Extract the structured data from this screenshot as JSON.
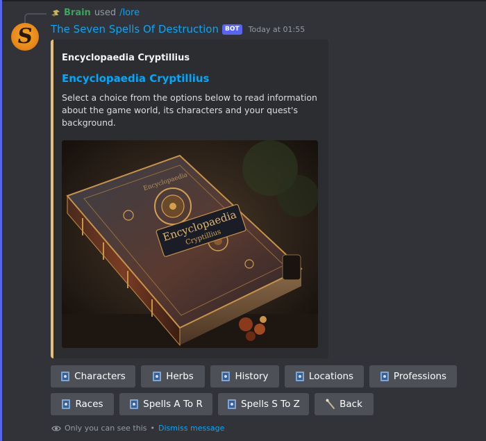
{
  "reply": {
    "name": "Brain",
    "action": "used",
    "command": "/lore"
  },
  "message": {
    "author": "The Seven Spells Of Destruction",
    "badge": "BOT",
    "timestamp": "Today at 01:55"
  },
  "embed": {
    "author": "Encyclopaedia Cryptillius",
    "title": "Encyclopaedia Cryptillius",
    "description": "Select a choice from the options below to read information about the game world, its characters and your quest's background.",
    "accent_color": "#e6c07b",
    "image_title_line1": "Encyclopaedia",
    "image_title_line2": "Cryptillius",
    "image_spine_text": "Encyclopaedia"
  },
  "buttons": [
    {
      "label": "Characters",
      "icon": "book-icon"
    },
    {
      "label": "Herbs",
      "icon": "book-icon"
    },
    {
      "label": "History",
      "icon": "book-icon"
    },
    {
      "label": "Locations",
      "icon": "book-icon"
    },
    {
      "label": "Professions",
      "icon": "book-icon"
    },
    {
      "label": "Races",
      "icon": "book-icon"
    },
    {
      "label": "Spells A To R",
      "icon": "book-icon"
    },
    {
      "label": "Spells S To Z",
      "icon": "book-icon"
    },
    {
      "label": "Back",
      "icon": "wand-icon"
    }
  ],
  "footer": {
    "notice": "Only you can see this",
    "separator": "•",
    "dismiss": "Dismiss message"
  },
  "colors": {
    "background": "#313338",
    "button": "#4e5058",
    "link": "#00a8fc",
    "badge": "#5865f2"
  }
}
